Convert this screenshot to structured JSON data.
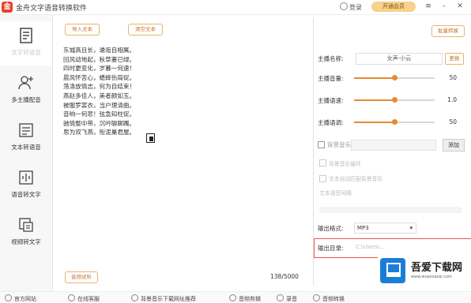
{
  "window": {
    "title": "金舟文字语音转换软件",
    "login_label": "登录",
    "vip_label": "开通会员"
  },
  "sidebar": {
    "items": [
      {
        "label": "文字转语音"
      },
      {
        "label": "多主播配音"
      },
      {
        "label": "文本转语音"
      },
      {
        "label": "语音转文字"
      },
      {
        "label": "视频转文字"
      }
    ]
  },
  "editor": {
    "import_button": "导入文本",
    "clear_button": "清空文本",
    "poem_lines": [
      "东城高且长，逶迤自相属。",
      "回风动地起，秋草萋已绿。",
      "四时更变化，岁暮一何速！",
      "晨风怀苦心，蟋蟀伤局促。",
      "荡涤放情志，何为自结束！",
      "燕赵多佳人，美者颜如玉。",
      "被服罗裳衣，当户理清曲。",
      "音响一何悲！弦急知柱促。",
      "驰情整中带，沉吟聊踯躅。",
      "思为双飞燕，衔泥巢君屋。"
    ],
    "char_count": "138/5000",
    "preview_button": "音频试听"
  },
  "panel": {
    "top_button": "批量转换",
    "anchor_name_label": "主播名称:",
    "anchor_name_value": "女声-小云",
    "change_button": "更换",
    "volume_label": "主播音量:",
    "volume_value": "50",
    "speed_label": "主播语速:",
    "speed_value": "1.0",
    "pitch_label": "主播语调:",
    "pitch_value": "50",
    "bg_music_label": "背景音乐:",
    "add_button": "添加",
    "loop_bg_label": "背景音乐循环",
    "auto_adjust_label": "文本自动匹配背景音乐",
    "interval_label": "文本语音间隔",
    "output_format_label": "输出格式:",
    "output_format_value": "MP3",
    "output_dir_label": "输出目录:",
    "output_dir_placeholder": "C:\\Users\\..."
  },
  "watermark": {
    "title": "吾爱下载网",
    "url": "www.wuaixiazai.com"
  },
  "footer": {
    "items": [
      {
        "label": "官方网站"
      },
      {
        "label": "在线客服"
      },
      {
        "label": "背景音乐下载网址推荐"
      },
      {
        "label": "音频剪辑"
      },
      {
        "label": "录音"
      },
      {
        "label": "音频转换"
      }
    ]
  },
  "colors": {
    "accent": "#e68a2e",
    "brand": "#e8412c",
    "highlight_border": "#f05050"
  },
  "slider_levels": {
    "volume": 0.5,
    "speed": 0.5,
    "pitch": 0.5
  }
}
